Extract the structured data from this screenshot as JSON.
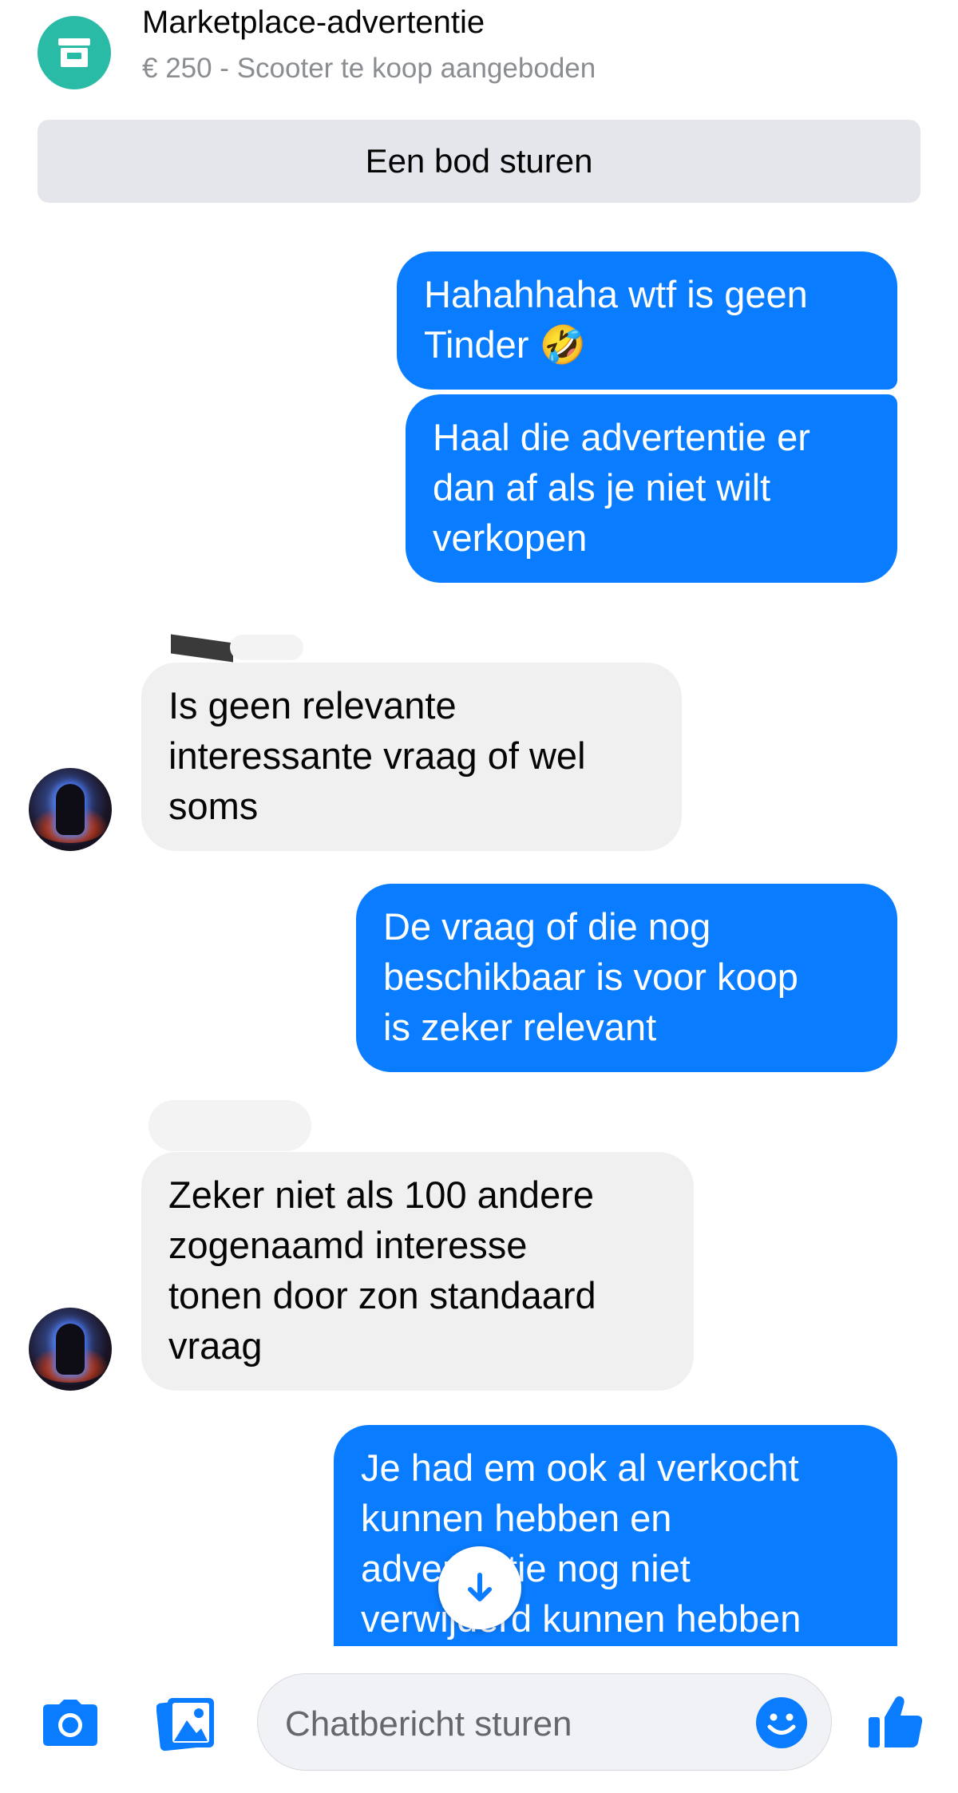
{
  "header": {
    "title": "Marketplace-advertentie",
    "subtitle": "€ 250 - Scooter te koop aangeboden",
    "icon": "marketplace-store-icon"
  },
  "offer_button": {
    "label": "Een bod sturen"
  },
  "messages": [
    {
      "direction": "sent",
      "lines": [
        "Hahahhaha wtf is geen",
        "Tinder 🤣"
      ]
    },
    {
      "direction": "sent",
      "lines": [
        "Haal die advertentie er",
        "dan af als je niet wilt",
        "verkopen"
      ]
    },
    {
      "direction": "received",
      "lines": [
        "Is geen relevante",
        "interessante vraag of wel",
        "soms"
      ]
    },
    {
      "direction": "sent",
      "lines": [
        "De vraag of die nog",
        "beschikbaar is voor koop",
        "is zeker relevant"
      ]
    },
    {
      "direction": "received",
      "lines": [
        "Zeker niet als 100 andere",
        "zogenaamd interesse",
        "tonen door zon standaard",
        "vraag"
      ]
    },
    {
      "direction": "sent",
      "lines": [
        "Je had em ook al verkocht",
        "kunnen hebben en",
        "advertentie nog niet",
        "verwijderd kunnen hebben"
      ]
    }
  ],
  "composer": {
    "placeholder": "Chatbericht sturen",
    "icons": [
      "camera-icon",
      "gallery-icon",
      "emoji-icon",
      "thumbs-up-icon"
    ]
  },
  "colors": {
    "sent_bubble": "#0a7cff",
    "received_bubble": "#f0f0f0",
    "marketplace_badge": "#2abba7",
    "accent": "#0a7cff"
  }
}
